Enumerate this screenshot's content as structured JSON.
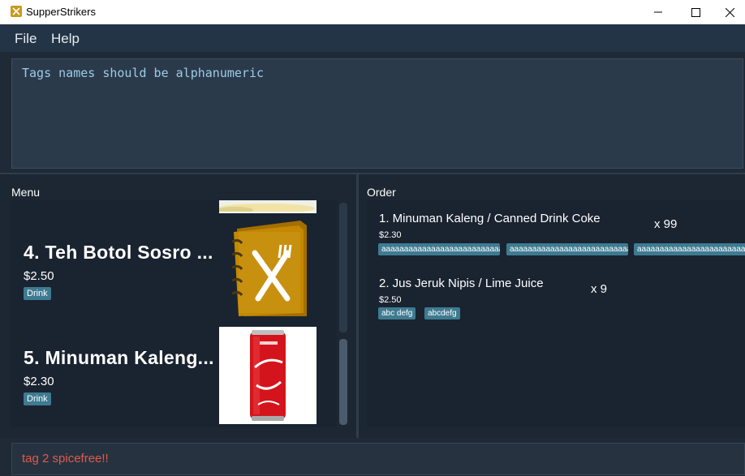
{
  "window": {
    "title": "SupperStrikers",
    "controls": [
      "minimize-icon",
      "maximize-icon",
      "close-icon"
    ]
  },
  "menubar": {
    "items": [
      {
        "label": "File"
      },
      {
        "label": "Help"
      }
    ]
  },
  "result_display": {
    "text": "Tags names should be alphanumeric"
  },
  "menu_panel": {
    "label": "Menu",
    "items": [
      {
        "index": 4,
        "name": "4.  Teh Botol Sosro ...",
        "price": "$2.50",
        "tags": [
          "Drink"
        ],
        "image": "menu-book-icon"
      },
      {
        "index": 5,
        "name": "5.  Minuman Kaleng...",
        "price": "$2.30",
        "tags": [
          "Drink"
        ],
        "image": "coca-cola-can"
      }
    ]
  },
  "order_panel": {
    "label": "Order",
    "items": [
      {
        "name": "1.  Minuman Kaleng / Canned Drink Coke",
        "quantity": "x 99",
        "price": "$2.30",
        "tags": [
          "aaaaaaaaaaaaaaaaaaaaaaaaaaaaaaaaaaa",
          "aaaaaaaaaaaaaaaaaaaaaaaaaaaaaaaaaaa",
          "aaaaaaaaaaaaaaaaaaaaaaaaaaaaaaaaaaa"
        ]
      },
      {
        "name": "2.  Jus Jeruk Nipis / Lime Juice",
        "quantity": "x 9",
        "price": "$2.50",
        "tags": [
          "abc defg",
          "abcdefg"
        ]
      }
    ]
  },
  "command_box": {
    "value": "tag 2 spicefree!!"
  },
  "colors": {
    "background": "#1d2733",
    "panel": "#1a2330",
    "tag": "#3e7b91",
    "command_error": "#e05a4c",
    "result_text": "#9ccbe8"
  }
}
